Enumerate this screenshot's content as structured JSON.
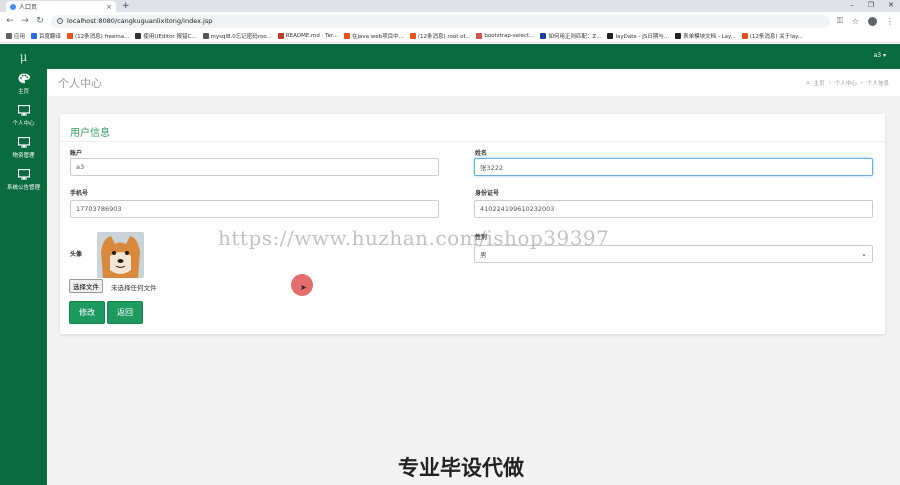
{
  "browser": {
    "tab_title": "人口页",
    "url": "localhost:8080/cangkuguanlixitong/index.jsp",
    "bookmarks": [
      {
        "label": "应用",
        "color": "#5f6368"
      },
      {
        "label": "百度翻译",
        "color": "#2b6de0"
      },
      {
        "label": "(12条消息) freema...",
        "color": "#e8501f"
      },
      {
        "label": "使用UEditor 报错C...",
        "color": "#333333"
      },
      {
        "label": "mysql8.0忘记密码roo...",
        "color": "#555555"
      },
      {
        "label": "README.md · Ter...",
        "color": "#c0392b"
      },
      {
        "label": "在java web项目中...",
        "color": "#e8501f"
      },
      {
        "label": "(12条消息) root of...",
        "color": "#e8501f"
      },
      {
        "label": "bootstrap-select...",
        "color": "#d9534f"
      },
      {
        "label": "如何用正则匹配：Z...",
        "color": "#1a3fa0"
      },
      {
        "label": "layDate - JS日期与...",
        "color": "#222222"
      },
      {
        "label": "表单模块文档 - Lay...",
        "color": "#222222"
      },
      {
        "label": "(12条消息) 关于lay...",
        "color": "#e8501f"
      }
    ]
  },
  "app": {
    "logo": "μ",
    "user_menu": "a3 ▾",
    "sidebar": [
      {
        "label": "主页",
        "icon": "palette-icon"
      },
      {
        "label": "个人中心",
        "icon": "monitor-icon"
      },
      {
        "label": "物资管理",
        "icon": "monitor-icon"
      },
      {
        "label": "系统公告管理",
        "icon": "monitor-icon"
      }
    ],
    "page_title": "个人中心",
    "breadcrumb": {
      "home": "主页",
      "sep": "›",
      "level1": "个人中心",
      "level2": "个人信息"
    }
  },
  "form": {
    "title": "用户信息",
    "account_label": "账户",
    "account_value": "a3",
    "name_label": "姓名",
    "name_value": "张3222",
    "phone_label": "手机号",
    "phone_value": "17703786903",
    "idcard_label": "身份证号",
    "idcard_value": "410224199610232003",
    "avatar_label": "头像",
    "gender_label": "性别",
    "gender_value": "男",
    "file_button": "选择文件",
    "file_status": "未选择任何文件",
    "modify_button": "修改",
    "back_button": "返回"
  },
  "overlay": {
    "watermark": "https://www.huzhan.com/ishop39397",
    "banner": "专业毕设代做"
  }
}
